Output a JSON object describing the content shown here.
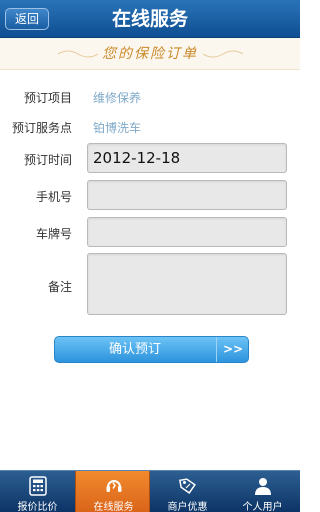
{
  "header": {
    "back_label": "返回",
    "title": "在线服务"
  },
  "subtitle": "您的保险订单",
  "form": {
    "item_label": "预订项目",
    "item_value": "维修保养",
    "point_label": "预订服务点",
    "point_value": "铂博洗车",
    "time_label": "预订时间",
    "time_value": "2012-12-18",
    "phone_label": "手机号",
    "phone_value": "",
    "plate_label": "车牌号",
    "plate_value": "",
    "note_label": "备注",
    "note_value": ""
  },
  "confirm": {
    "label": "确认预订",
    "arrow": ">>"
  },
  "tabs": [
    {
      "label": "报价比价",
      "icon": "calculator-icon"
    },
    {
      "label": "在线服务",
      "icon": "headset-icon",
      "active": true
    },
    {
      "label": "商户优惠",
      "icon": "price-tag-icon"
    },
    {
      "label": "个人用户",
      "icon": "user-icon"
    }
  ],
  "colors": {
    "header": "#1a5ea3",
    "active_tab": "#e8731f",
    "subtitle": "#c98a2a"
  }
}
